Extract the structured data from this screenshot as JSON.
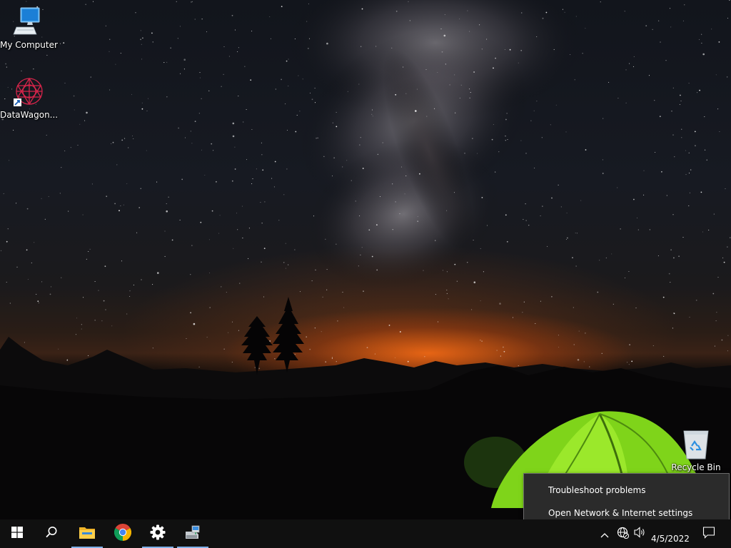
{
  "desktop": {
    "icons": [
      {
        "label": "My Computer",
        "icon": "computer-icon"
      },
      {
        "label": "DataWagon...",
        "icon": "datawagon-icon"
      },
      {
        "label": "Recycle Bin",
        "icon": "recycle-bin-icon"
      }
    ]
  },
  "context_menu": {
    "items": [
      {
        "label": "Troubleshoot problems"
      },
      {
        "label": "Open Network & Internet settings"
      }
    ]
  },
  "taskbar": {
    "buttons": [
      {
        "name": "start",
        "icon": "windows-logo-icon"
      },
      {
        "name": "search",
        "icon": "search-icon"
      },
      {
        "name": "file-explorer",
        "icon": "folder-icon",
        "active": true
      },
      {
        "name": "chrome",
        "icon": "chrome-icon",
        "active": false
      },
      {
        "name": "settings",
        "icon": "gear-icon",
        "active": true
      },
      {
        "name": "network-app",
        "icon": "network-drive-icon",
        "active": true
      }
    ],
    "tray": {
      "icons": [
        "chevron-up-icon",
        "network-icon",
        "volume-icon"
      ],
      "date": "4/5/2022",
      "notification_icon": "notification-icon"
    }
  },
  "colors": {
    "taskbar": "#101010",
    "menu_bg": "#2b2b2b",
    "accent_underline": "#7fb0e8",
    "tent_green": "#8ee01c",
    "horizon_orange": "#ff6e14"
  }
}
